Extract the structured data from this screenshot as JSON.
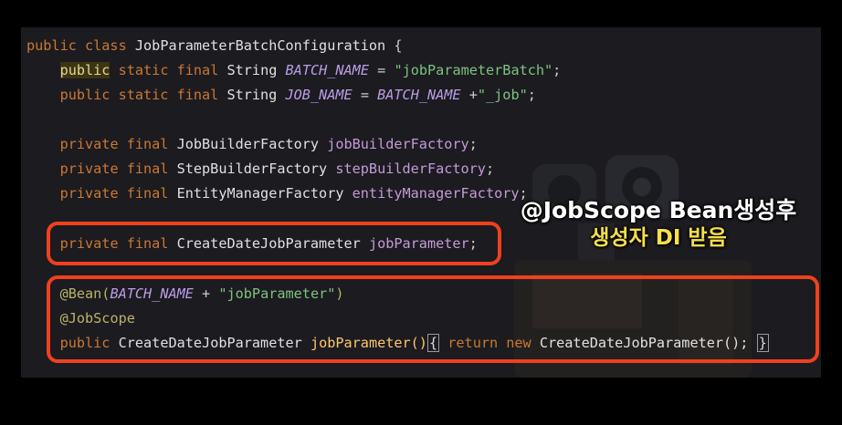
{
  "code": {
    "l1": {
      "kw": "public class",
      "name": "JobParameterBatchConfiguration",
      "open": "{"
    },
    "l2": {
      "kw_hl": "public",
      "kw": "static final",
      "type": "String",
      "field": "BATCH_NAME",
      "eq": "=",
      "str": "\"jobParameterBatch\"",
      "end": ";"
    },
    "l3": {
      "kw": "public static final",
      "type": "String",
      "field": "JOB_NAME",
      "eq": "=",
      "ref": "BATCH_NAME",
      "plus": "+",
      "str": "\"_job\"",
      "end": ";"
    },
    "l4": {
      "kw": "private final",
      "type": "JobBuilderFactory",
      "field": "jobBuilderFactory",
      "end": ";"
    },
    "l5": {
      "kw": "private final",
      "type": "StepBuilderFactory",
      "field": "stepBuilderFactory",
      "end": ";"
    },
    "l6": {
      "kw": "private final",
      "type": "EntityManagerFactory",
      "field": "entityManagerFactory",
      "end": ";"
    },
    "l7": {
      "kw": "private final",
      "type": "CreateDateJobParameter",
      "field": "jobParameter",
      "end": ";"
    },
    "l8": {
      "ann": "@Bean(",
      "ref": "BATCH_NAME",
      "plus": "+",
      "str": "\"jobParameter\"",
      "close": ")"
    },
    "l9": {
      "ann": "@JobScope"
    },
    "l10": {
      "kw": "public",
      "type": "CreateDateJobParameter",
      "method": "jobParameter()",
      "lbrace": "{",
      "ret": "return new",
      "ctor": "CreateDateJobParameter();",
      "rbrace": "}"
    }
  },
  "caption": {
    "line1": "@JobScope Bean생성후",
    "line2": "생성자 DI 받음"
  },
  "colors": {
    "highlight_box": "#f0401e",
    "caption_main": "#ffffff",
    "caption_sub": "#f6e04a"
  }
}
